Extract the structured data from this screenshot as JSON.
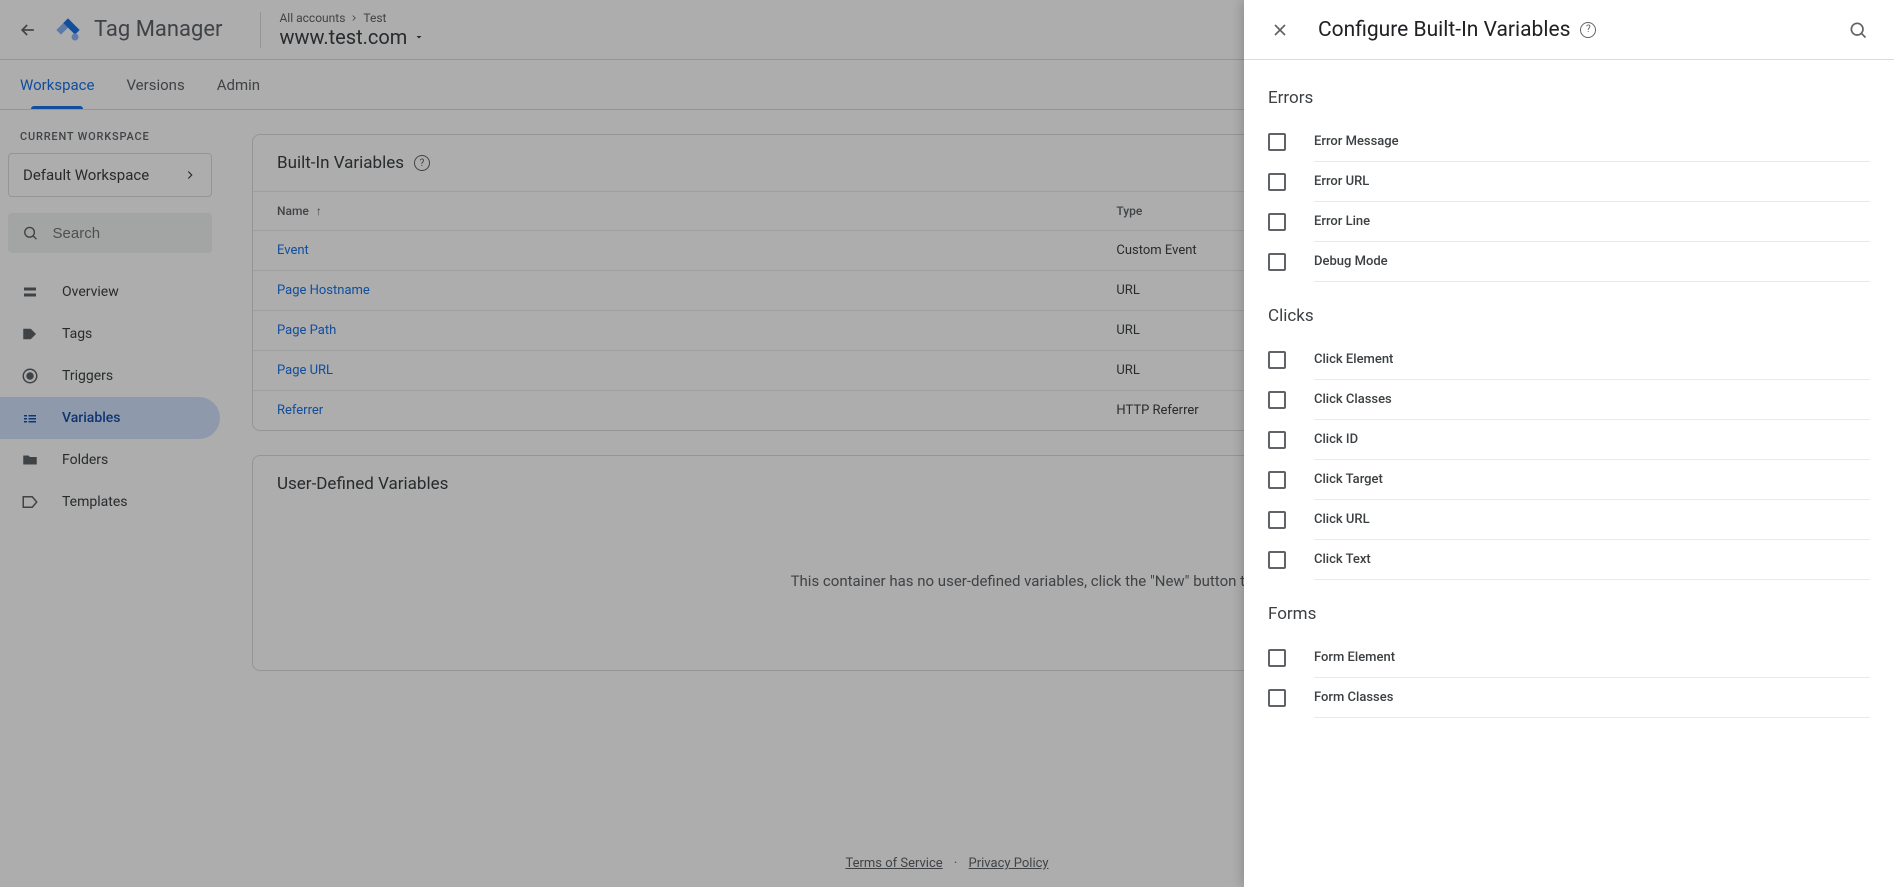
{
  "header": {
    "product_name": "Tag Manager",
    "breadcrumb_all": "All accounts",
    "breadcrumb_account": "Test",
    "container_name": "www.test.com"
  },
  "tabs": {
    "workspace": "Workspace",
    "versions": "Versions",
    "admin": "Admin"
  },
  "sidebar": {
    "heading": "CURRENT WORKSPACE",
    "workspace_name": "Default Workspace",
    "search_placeholder": "Search",
    "items": [
      {
        "label": "Overview"
      },
      {
        "label": "Tags"
      },
      {
        "label": "Triggers"
      },
      {
        "label": "Variables"
      },
      {
        "label": "Folders"
      },
      {
        "label": "Templates"
      }
    ]
  },
  "cards": {
    "builtin": {
      "title": "Built-In Variables",
      "col_name": "Name",
      "col_type": "Type",
      "rows": [
        {
          "name": "Event",
          "type": "Custom Event"
        },
        {
          "name": "Page Hostname",
          "type": "URL"
        },
        {
          "name": "Page Path",
          "type": "URL"
        },
        {
          "name": "Page URL",
          "type": "URL"
        },
        {
          "name": "Referrer",
          "type": "HTTP Referrer"
        }
      ]
    },
    "userdef": {
      "title": "User-Defined Variables",
      "empty_text": "This container has no user-defined variables, click the \"New\" button to create one."
    }
  },
  "footer": {
    "tos": "Terms of Service",
    "privacy": "Privacy Policy"
  },
  "panel": {
    "title": "Configure Built-In Variables",
    "groups": [
      {
        "heading": "Errors",
        "items": [
          "Error Message",
          "Error URL",
          "Error Line",
          "Debug Mode"
        ]
      },
      {
        "heading": "Clicks",
        "items": [
          "Click Element",
          "Click Classes",
          "Click ID",
          "Click Target",
          "Click URL",
          "Click Text"
        ]
      },
      {
        "heading": "Forms",
        "items": [
          "Form Element",
          "Form Classes"
        ]
      }
    ]
  }
}
